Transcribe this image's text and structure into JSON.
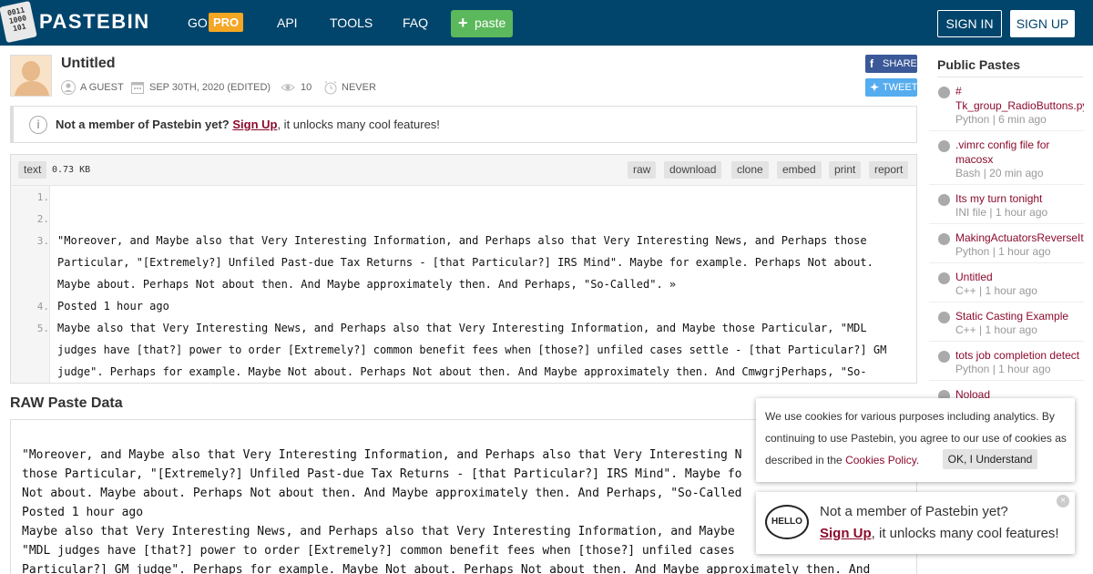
{
  "header": {
    "logo_icon": "0011 1000 101",
    "logo": "PASTEBIN",
    "nav": {
      "go": "GO",
      "pro": "PRO",
      "api": "API",
      "tools": "TOOLS",
      "faq": "FAQ"
    },
    "paste_label": "paste",
    "sign_in": "SIGN IN",
    "sign_up": "SIGN UP",
    "bg_color": "#02456c"
  },
  "paste": {
    "title": "Untitled",
    "author": "A GUEST",
    "date": "SEP 30TH, 2020 (EDITED)",
    "views": "10",
    "expire": "NEVER",
    "share": "SHARE",
    "tweet": "TWEET"
  },
  "notice": {
    "bold": "Not a member of Pastebin yet?",
    "link": "Sign Up",
    "rest": ", it unlocks many cool features!"
  },
  "code": {
    "syntax": "text",
    "size": "0.73 KB",
    "actions": [
      "raw",
      "download",
      "clone",
      "embed",
      "print",
      "report"
    ],
    "line_numbers": [
      "1.",
      "2.",
      "3.",
      "4.",
      "5."
    ],
    "lines": [
      "",
      "",
      "\"Moreover, and Maybe also that Very Interesting Information, and Perhaps also that Very Interesting News, and Perhaps those Particular, \"[Extremely?] Unfiled Past-due Tax Returns - [that Particular?] IRS Mind\". Maybe for example. Perhaps Not about. Maybe about. Perhaps Not about then. And Maybe approximately then. And Perhaps, \"So-Called\". »",
      "Posted 1 hour ago",
      "Maybe also that Very Interesting News, and Perhaps also that Very Interesting Information, and Maybe those Particular, \"MDL judges have [that?] power to order [Extremely?] common benefit fees when [those?] unfiled cases settle - [that Particular?] GM judge\". Perhaps for example. Maybe Not about. Perhaps Not about then. And Maybe approximately then. And CmwgrjPerhaps, \"So-called\"."
    ]
  },
  "raw": {
    "title": "RAW Paste Data",
    "lines": [
      "\"Moreover, and Maybe also that Very Interesting Information, and Perhaps also that Very Interesting N",
      "those Particular, \"[Extremely?] Unfiled Past-due Tax Returns - [that Particular?] IRS Mind\". Maybe fo",
      "Not about. Maybe about. Perhaps Not about then. And Maybe approximately then. And Perhaps, \"So-Called",
      "Posted 1 hour ago",
      "Maybe also that Very Interesting News, and Perhaps also that Very Interesting Information, and Maybe",
      "\"MDL judges have [that?] power to order [Extremely?] common benefit fees when [those?] unfiled cases",
      "Particular?] GM judge\". Perhaps for example. Maybe Not about. Perhaps Not about then. And Maybe approximately then. And"
    ]
  },
  "sidebar": {
    "title": "Public Pastes",
    "items": [
      {
        "name": "# Tk_group_RadioButtons.py",
        "lang": "Python",
        "time": "6 min ago"
      },
      {
        "name": ".vimrc config file for macosx",
        "lang": "Bash",
        "time": "20 min ago"
      },
      {
        "name": "Its my turn tonight",
        "lang": "INI file",
        "time": "1 hour ago"
      },
      {
        "name": "MakingActuatorsReverseIt",
        "lang": "Python",
        "time": "1 hour ago"
      },
      {
        "name": "Untitled",
        "lang": "C++",
        "time": "1 hour ago"
      },
      {
        "name": "Static Casting Example",
        "lang": "C++",
        "time": "1 hour ago"
      },
      {
        "name": "tots job completion detect",
        "lang": "Python",
        "time": "1 hour ago"
      },
      {
        "name": "Noload",
        "lang": "",
        "time": ""
      }
    ]
  },
  "cookie": {
    "text_before": "We use cookies for various purposes including analytics. By continuing to use Pastebin, you agree to our use of cookies as described in the ",
    "link": "Cookies Policy",
    "after": ".",
    "ok": "OK, I Understand"
  },
  "member_popup": {
    "hello": "HELLO",
    "line1": "Not a member of Pastebin yet?",
    "link": "Sign Up",
    "line2_rest": ", it unlocks many cool features!",
    "close": "×"
  }
}
